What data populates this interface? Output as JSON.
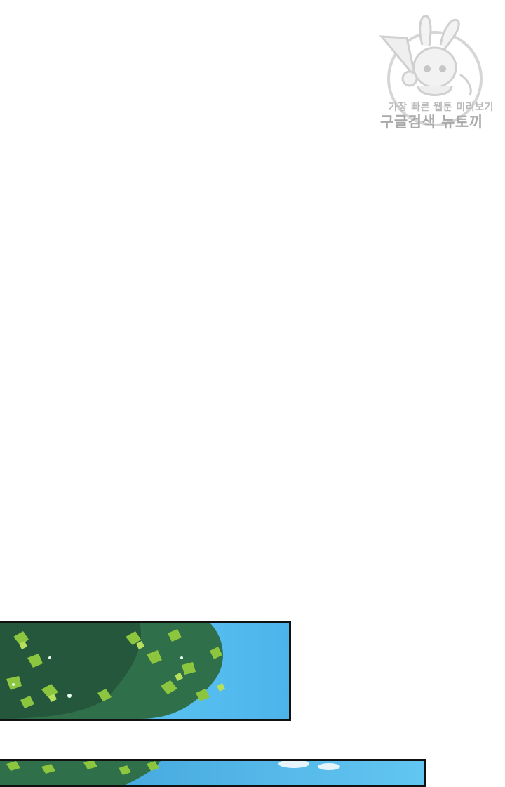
{
  "watermark": {
    "line1": "가장 빠른 웹툰 미리보기",
    "line2": "구글검색 뉴토끼",
    "icon": "bunny-mascot-icon",
    "color": "#b0b0b0"
  },
  "panels": [
    {
      "scene": "tree-foliage-sky",
      "sky_color": "#4fb8ec",
      "leaf_color": "#6fae3a"
    },
    {
      "scene": "tree-foliage-sky",
      "sky_color": "#5cc0ee",
      "leaf_color": "#6fae3a"
    }
  ]
}
